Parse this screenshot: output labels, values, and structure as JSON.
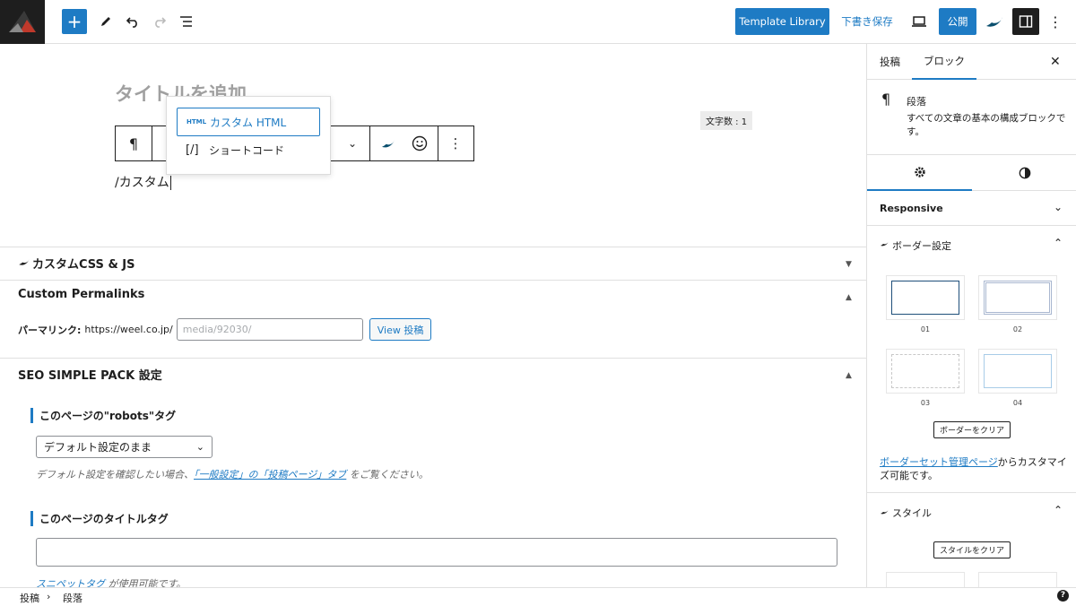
{
  "topbar": {
    "template_library": "Template Library",
    "save_draft": "下書き保存",
    "publish": "公開"
  },
  "editor": {
    "title_placeholder": "タイトルを追加",
    "word_count": "文字数 : 1",
    "paragraph_text": "/カスタム",
    "autocomplete": [
      {
        "icon": "HTML",
        "label": "カスタム HTML"
      },
      {
        "icon": "[/]",
        "label": "ショートコード"
      }
    ]
  },
  "metaboxes": {
    "custom_css_js": "カスタムCSS & JS",
    "custom_permalinks": {
      "title": "Custom Permalinks",
      "label": "パーマリンク:",
      "base_url": "https://weel.co.jp/",
      "placeholder": "media/92030/",
      "view_button": "View 投稿"
    },
    "seo": {
      "title": "SEO SIMPLE PACK 設定",
      "robots_heading": "このページの\"robots\"タグ",
      "robots_select": "デフォルト設定のまま",
      "robots_note_prefix": "デフォルト設定を確認したい場合、",
      "robots_note_link": "「一般設定」の「投稿ページ」タブ",
      "robots_note_suffix": " をご覧ください。",
      "title_tag_heading": "このページのタイトルタグ",
      "snippet_link": "スニペットタグ",
      "snippet_suffix": " が使用可能です。"
    }
  },
  "sidebar": {
    "tabs": [
      "投稿",
      "ブロック"
    ],
    "block_name": "段落",
    "block_description": "すべての文章の基本の構成ブロックです。",
    "responsive": "Responsive",
    "border_settings": "ボーダー設定",
    "border_options": [
      "01",
      "02",
      "03",
      "04"
    ],
    "clear_border": "ボーダーをクリア",
    "border_note_link": "ボーダーセット管理ページ",
    "border_note_suffix": "からカスタマイズ可能です。",
    "style": "スタイル",
    "clear_style": "スタイルをクリア"
  },
  "footer": {
    "crumbs": [
      "投稿",
      "段落"
    ]
  },
  "colors": {
    "accent": "#1e7bc4",
    "dark": "#1e1e1e"
  }
}
